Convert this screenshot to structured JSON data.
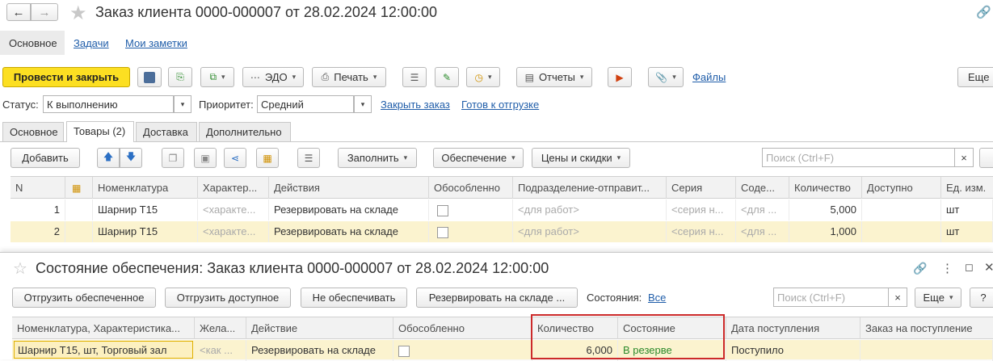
{
  "window": {
    "title": "Заказ клиента 0000-000007 от 28.02.2024 12:00:00"
  },
  "nav": {
    "tabs": [
      "Основное",
      "Задачи",
      "Мои заметки"
    ]
  },
  "toolbar": {
    "post_close": "Провести и закрыть",
    "edo": "ЭДО",
    "print": "Печать",
    "reports": "Отчеты",
    "files": "Файлы",
    "more": "Еще"
  },
  "form": {
    "status_label": "Статус:",
    "status_value": "К выполнению",
    "priority_label": "Приоритет:",
    "priority_value": "Средний",
    "close_order": "Закрыть заказ",
    "ready_ship": "Готов к отгрузке"
  },
  "tabs": [
    {
      "label": "Основное",
      "active": false
    },
    {
      "label": "Товары (2)",
      "active": true
    },
    {
      "label": "Доставка",
      "active": false
    },
    {
      "label": "Дополнительно",
      "active": false
    }
  ],
  "goods_toolbar": {
    "add": "Добавить",
    "fill": "Заполнить",
    "supply": "Обеспечение",
    "prices": "Цены и скидки",
    "search_placeholder": "Поиск (Ctrl+F)",
    "clear": "×"
  },
  "goods_table": {
    "headers": [
      "N",
      "",
      "Номенклатура",
      "Характер...",
      "Действия",
      "Обособленно",
      "Подразделение-отправит...",
      "Серия",
      "Соде...",
      "Количество",
      "Доступно",
      "Ед. изм."
    ],
    "rows": [
      {
        "n": "1",
        "item": "Шарнир Т15",
        "char": "<характе...",
        "action": "Резервировать на складе",
        "dept": "<для работ>",
        "series": "<серия н...",
        "content": "<для ...",
        "qty": "5,000",
        "avail": "",
        "unit": "шт"
      },
      {
        "n": "2",
        "item": "Шарнир Т15",
        "char": "<характе...",
        "action": "Резервировать на складе",
        "dept": "<для работ>",
        "series": "<серия н...",
        "content": "<для ...",
        "qty": "1,000",
        "avail": "",
        "unit": "шт"
      }
    ]
  },
  "supply_panel": {
    "title": "Состояние обеспечения: Заказ клиента 0000-000007 от 28.02.2024 12:00:00",
    "ship_provided": "Отгрузить обеспеченное",
    "ship_available": "Отгрузить доступное",
    "not_provide": "Не обеспечивать",
    "reserve": "Резервировать на складе ...",
    "states_label": "Состояния:",
    "states_value": "Все",
    "search_placeholder": "Поиск (Ctrl+F)",
    "clear": "×",
    "more": "Еще",
    "help": "?",
    "headers": [
      "Номенклатура, Характеристика...",
      "Жела...",
      "Действие",
      "Обособленно",
      "Количество",
      "Состояние",
      "Дата поступления",
      "Заказ на поступление"
    ],
    "row": {
      "item": "Шарнир Т15, шт, Торговый зал",
      "desired": "<как ...",
      "action": "Резервировать на складе",
      "qty": "6,000",
      "state": "В резерве",
      "arrival": "Поступило",
      "order": ""
    }
  },
  "colors": {
    "accent": "#fcdf22",
    "link": "#1f5da9",
    "selected_row": "#fbf3cf",
    "highlight_border": "#cc2a2a",
    "state_green": "#2c8a2c"
  }
}
